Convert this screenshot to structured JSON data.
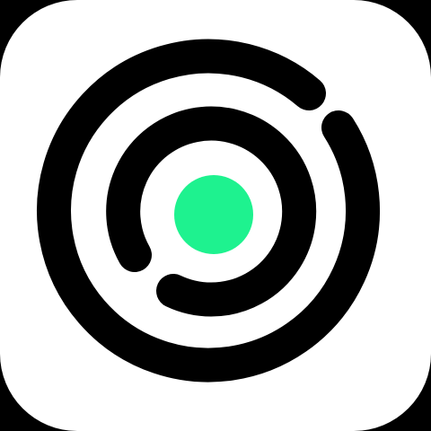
{
  "icon": {
    "name": "target-logo-icon",
    "colors": {
      "background": "#000000",
      "tile": "#ffffff",
      "rings": "#000000",
      "center_dot": "#1ef28f"
    }
  }
}
